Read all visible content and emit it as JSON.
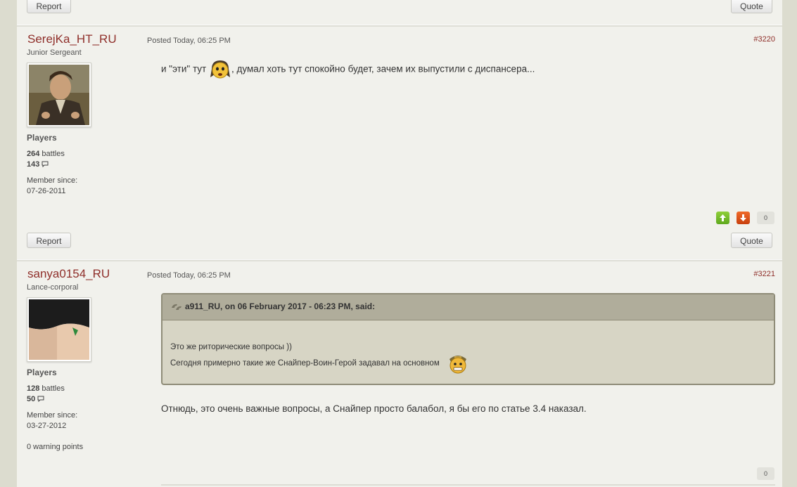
{
  "top": {
    "report_label": "Report",
    "quote_label": "Quote"
  },
  "posts": [
    {
      "username": "SerejKa_HT_RU",
      "rank": "Junior Sergeant",
      "group": "Players",
      "battles": "264",
      "battles_label": "battles",
      "post_count": "143",
      "member_since_label": "Member since:",
      "member_since": "07-26-2011",
      "posted": "Posted Today, 06:25 PM",
      "post_number": "#3220",
      "text_before": "и \"эти\" тут",
      "text_after": ", думал хоть тут спокойно будет, зачем их выпустили с диспансера...",
      "rep_count": "0",
      "report_label": "Report",
      "quote_label": "Quote"
    },
    {
      "username": "sanya0154_RU",
      "rank": "Lance-corporal",
      "group": "Players",
      "battles": "128",
      "battles_label": "battles",
      "post_count": "50",
      "member_since_label": "Member since:",
      "member_since": "03-27-2012",
      "warning_points": "0 warning points",
      "posted": "Posted Today, 06:25 PM",
      "post_number": "#3221",
      "quote": {
        "citation": "a911_RU, on 06 February 2017 - 06:23 PM, said:",
        "line1": "Это же риторические вопросы ))",
        "line2": "Сегодня примерно такие же Снайпер-Воин-Герой задавал на основном"
      },
      "text": "Отнюдь, это очень важные вопросы, а Снайпер просто балабол, я бы его по статье 3.4 наказал.",
      "rep_count": "0"
    }
  ],
  "colors": {
    "username": "#8f2f2a",
    "rep_up": "#6cb526",
    "rep_down": "#d94a14",
    "quote_border": "#8f8c78"
  },
  "icons": [
    "comment-icon",
    "quote-icon",
    "arrow-up-icon",
    "arrow-down-icon",
    "smiley-icon"
  ]
}
